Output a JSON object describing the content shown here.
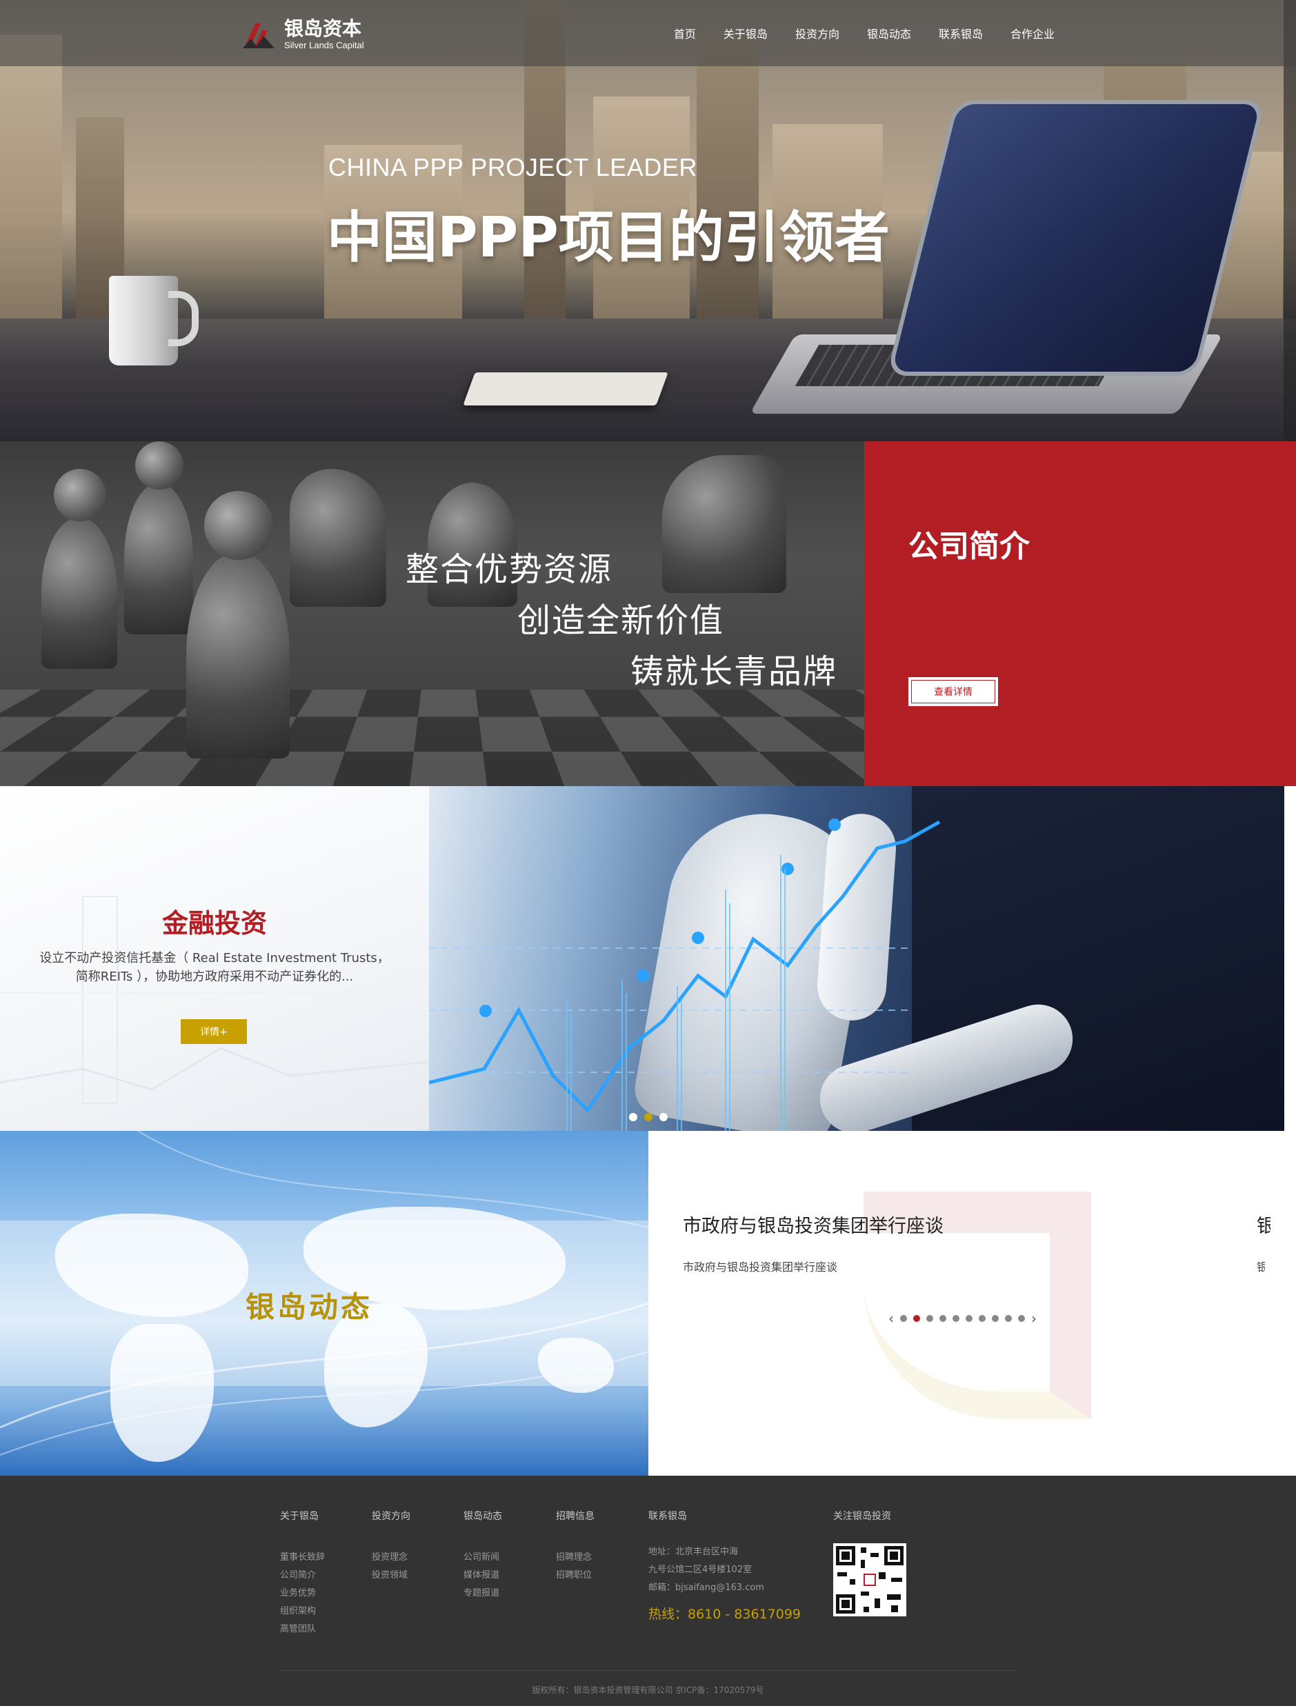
{
  "brand": {
    "name_cn": "银岛资本",
    "name_en": "Silver Lands Capital",
    "accent_red": "#b31e24",
    "accent_gold": "#c8a100"
  },
  "nav": {
    "items": [
      "首页",
      "关于银岛",
      "投资方向",
      "银岛动态",
      "联系银岛",
      "合作企业"
    ]
  },
  "hero": {
    "subtitle_en": "CHINA PPP PROJECT LEADER",
    "title": "中国PPP项目的引领者"
  },
  "intro": {
    "slogans": [
      "整合优势资源",
      "创造全新价值",
      "铸就长青品牌"
    ],
    "panel_title": "公司简介",
    "button_label": "查看详情"
  },
  "finance": {
    "title": "金融投资",
    "description": "设立不动产投资信托基金（ Real Estate Investment Trusts，简称REITs ），协助地方政府采用不动产证券化的...",
    "button_label": "详情+",
    "slides_count": 3,
    "active_slide": 2
  },
  "news": {
    "section_title": "银岛动态",
    "item_title": "市政府与银岛投资集团举行座谈",
    "item_desc": "市政府与银岛投资集团举行座谈",
    "next_item_peek_title": "银",
    "next_item_peek_desc": "银",
    "prev_icon": "chevron-left-icon",
    "next_icon": "chevron-right-icon",
    "pages_count": 10,
    "active_page": 2
  },
  "footer": {
    "columns": [
      {
        "title": "关于银岛",
        "links": [
          "董事长致辞",
          "公司简介",
          "业务优势",
          "组织架构",
          "高管团队"
        ]
      },
      {
        "title": "投资方向",
        "links": [
          "投资理念",
          "投资领域"
        ]
      },
      {
        "title": "银岛动态",
        "links": [
          "公司新闻",
          "媒体报道",
          "专题报道"
        ]
      },
      {
        "title": "招聘信息",
        "links": [
          "招聘理念",
          "招聘职位"
        ]
      }
    ],
    "contact": {
      "title": "联系银岛",
      "address_line1": "地址：北京丰台区中海",
      "address_line2": "九号公馆二区4号楼102室",
      "email": "邮箱：bjsaifang@163.com",
      "hotline": "热线：8610 - 83617099"
    },
    "follow": {
      "title": "关注银岛投资"
    },
    "copyright": "版权所有：银岛资本投资管理有限公司  京ICP备：17020579号"
  }
}
